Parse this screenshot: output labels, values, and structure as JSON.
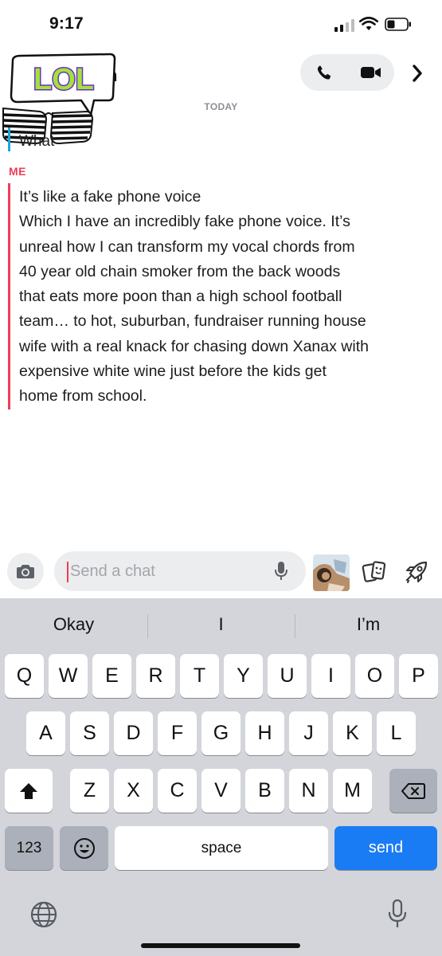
{
  "status_bar": {
    "time": "9:17"
  },
  "header": {
    "sticker_text": "LOL",
    "name_visible": "n",
    "buttons": [
      "phone-icon",
      "video-icon",
      "chevron-right-icon"
    ]
  },
  "thread": {
    "date_label": "TODAY",
    "friend_message": "What",
    "me_label": "ME",
    "me_lines": [
      "It’s like a fake phone voice",
      "Which I have an incredibly fake phone voice. It’s",
      "unreal how I can transform my vocal chords from",
      "40 year old chain smoker from the back woods",
      "that eats more poon than a high school football",
      "team… to hot, suburban, fundraiser running house",
      "wife with a real knack for chasing down Xanax with",
      "expensive white wine just before the kids get",
      "home from school."
    ]
  },
  "chat_bar": {
    "placeholder": "Send a chat",
    "value": ""
  },
  "keyboard": {
    "suggestions": [
      "Okay",
      "I",
      "I’m"
    ],
    "row1": [
      "Q",
      "W",
      "E",
      "R",
      "T",
      "Y",
      "U",
      "I",
      "O",
      "P"
    ],
    "row2": [
      "A",
      "S",
      "D",
      "F",
      "G",
      "H",
      "J",
      "K",
      "L"
    ],
    "row3": [
      "Z",
      "X",
      "C",
      "V",
      "B",
      "N",
      "M"
    ],
    "numbers_key": "123",
    "space_key": "space",
    "send_key": "send"
  },
  "colors": {
    "me_accent": "#ef3d57",
    "friend_accent": "#17a9e0",
    "send_key": "#1a7cf5",
    "keyboard_bg": "#d3d5db"
  }
}
